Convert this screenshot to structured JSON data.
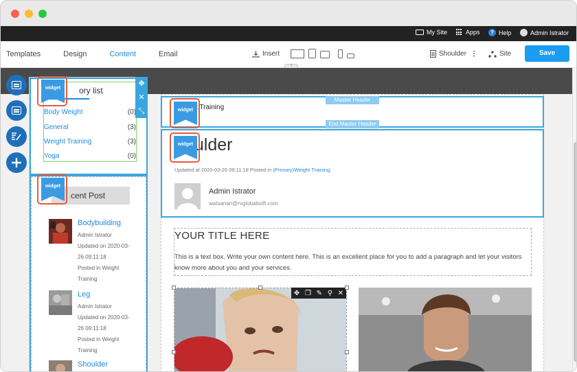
{
  "topnav": {
    "my_site": "My Site",
    "apps": "Apps",
    "help": "Help",
    "help_glyph": "?",
    "user": "Admin Istrator"
  },
  "toolbar": {
    "tabs": [
      {
        "label": "Templates"
      },
      {
        "label": "Design"
      },
      {
        "label": "Content"
      },
      {
        "label": "Email"
      }
    ],
    "active_tab": "Content",
    "insert_label": "Insert",
    "page_label": "Shoulder",
    "site_label": "Site",
    "save_label": "Save"
  },
  "sidebar": {
    "widget_badge": "widget",
    "category_title": "ory list",
    "categories": [
      {
        "name": "Body Weight",
        "count": "(0)"
      },
      {
        "name": "General",
        "count": "(3)"
      },
      {
        "name": "Weight Training",
        "count": "(3)"
      },
      {
        "name": "Yoga",
        "count": "(0)"
      }
    ],
    "recent_title": "cent Post",
    "recent_posts": [
      {
        "name": "Bodybuilding",
        "author": "Admin Istrator",
        "updated": "Updated on 2020-03-26 09:11:18",
        "posted": "Posted in Weight Training"
      },
      {
        "name": "Leg",
        "author": "Admin Istrator",
        "updated": "Updated on 2020-03-26 09:11:18",
        "posted": "Posted in Weight Training"
      },
      {
        "name": "Shoulder"
      }
    ]
  },
  "page": {
    "master_header_label": "Master Header",
    "master_header_end": "End Master Header",
    "header_text": "t Training",
    "post_title": "oulder",
    "post_meta": "Updated at 2020-03-26 09:11:18 Posted in ",
    "post_meta_link": "(Primary)Weight Training",
    "post_meta_end": ".",
    "author_name": "Admin Istrator",
    "author_email": "watsanan@rvglobalsoft.com",
    "textbox_title": "YOUR TITLE HERE",
    "textbox_body": "This is a text box. Write your own content here. This is an excellent place for you to add a paragraph and let your visitors know more about you and your services."
  },
  "colors": {
    "accent": "#1f8ae0",
    "save": "#1a9cf0",
    "widget_badge": "#3a9be3",
    "highlight_ring": "#e85b3b",
    "selection": "#39a6e0"
  }
}
